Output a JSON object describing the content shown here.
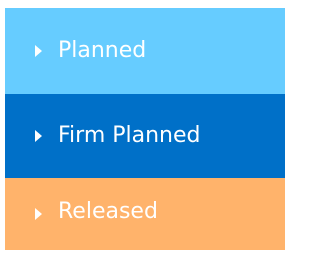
{
  "statuses": [
    {
      "label": "Planned",
      "color": "#66CCFF",
      "icon": "chevron-right-icon"
    },
    {
      "label": "Firm Planned",
      "color": "#0070C8",
      "icon": "chevron-right-icon"
    },
    {
      "label": "Released",
      "color": "#FFB36B",
      "icon": "chevron-right-icon"
    }
  ]
}
